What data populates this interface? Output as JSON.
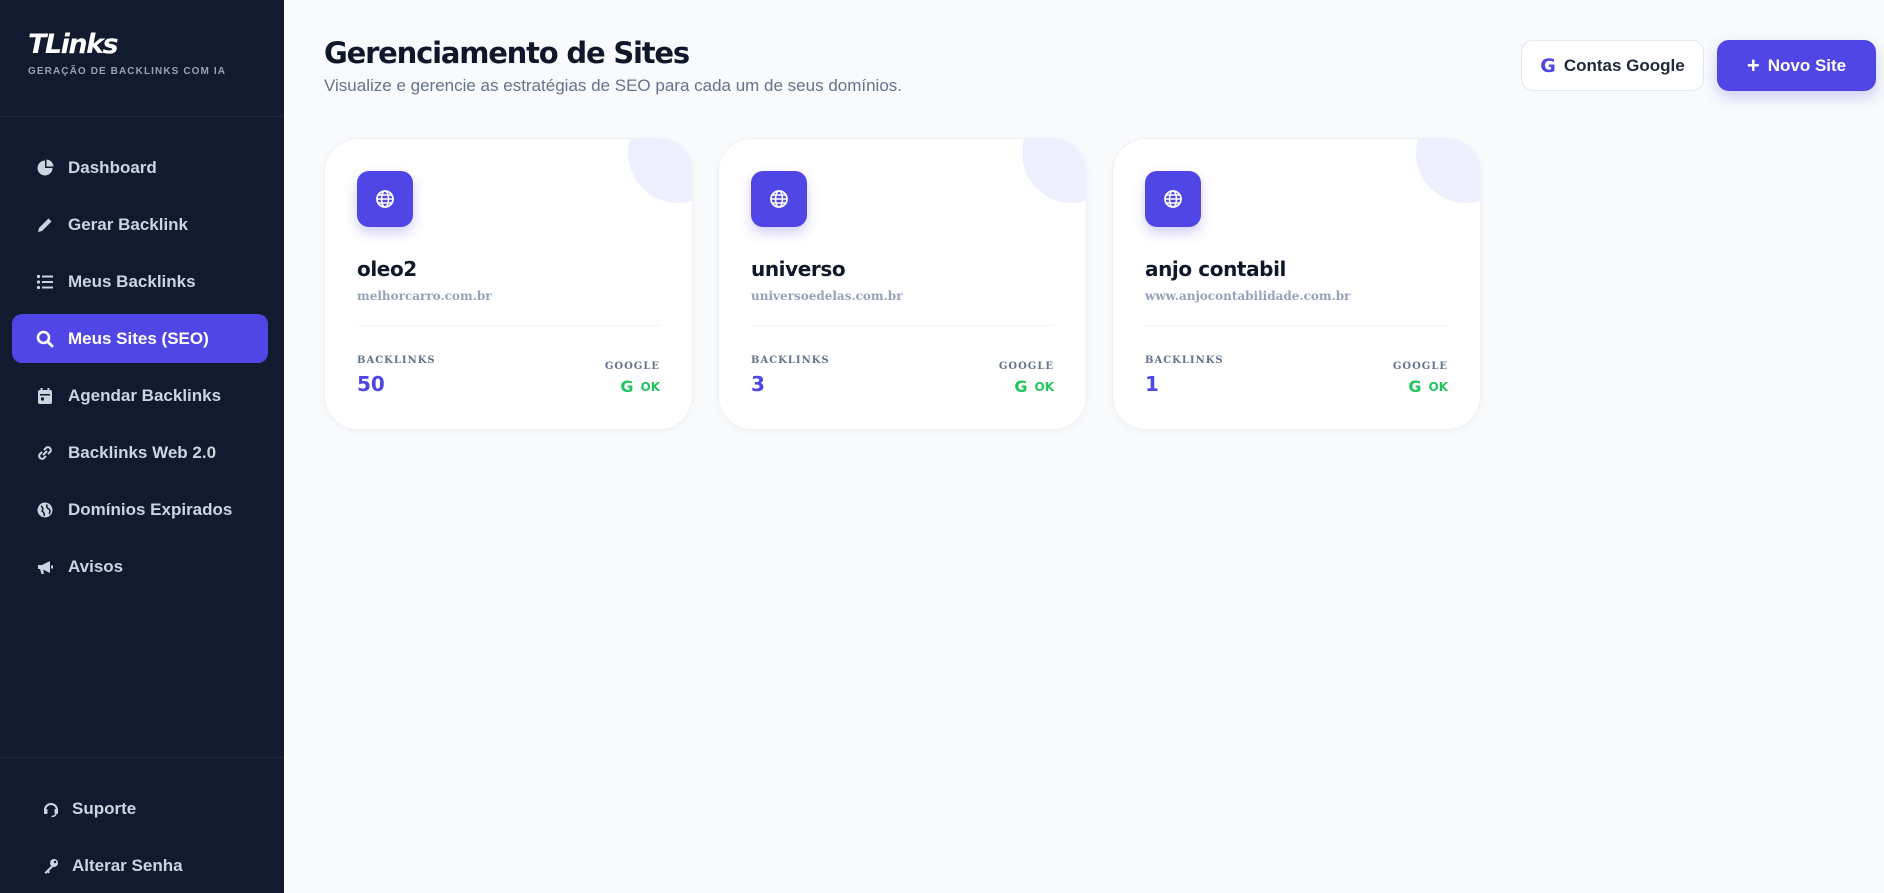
{
  "brand": {
    "name": "TLinks",
    "tagline": "GERAÇÃO DE BACKLINKS COM IA"
  },
  "sidebar": {
    "items": [
      {
        "label": "Dashboard",
        "icon": "pie-chart-icon",
        "active": false
      },
      {
        "label": "Gerar Backlink",
        "icon": "pencil-icon",
        "active": false
      },
      {
        "label": "Meus Backlinks",
        "icon": "list-icon",
        "active": false
      },
      {
        "label": "Meus Sites (SEO)",
        "icon": "search-icon",
        "active": true
      },
      {
        "label": "Agendar Backlinks",
        "icon": "calendar-icon",
        "active": false
      },
      {
        "label": "Backlinks Web 2.0",
        "icon": "link-icon",
        "active": false
      },
      {
        "label": "Domínios Expirados",
        "icon": "globe-icon",
        "active": false
      },
      {
        "label": "Avisos",
        "icon": "megaphone-icon",
        "active": false
      }
    ],
    "bottom": [
      {
        "label": "Suporte",
        "icon": "headset-icon"
      },
      {
        "label": "Alterar Senha",
        "icon": "key-icon"
      }
    ]
  },
  "header": {
    "title": "Gerenciamento de Sites",
    "subtitle": "Visualize e gerencie as estratégias de SEO para cada um de seus domínios.",
    "google_button": "Contas Google",
    "google_glyph": "G",
    "new_button": "Novo Site",
    "new_glyph": "+"
  },
  "labels": {
    "backlinks": "BACKLINKS",
    "google": "GOOGLE"
  },
  "sites": [
    {
      "name": "oleo2",
      "domain": "melhorcarro.com.br",
      "backlinks": "50",
      "google_status": "OK"
    },
    {
      "name": "universo",
      "domain": "universoedelas.com.br",
      "backlinks": "3",
      "google_status": "OK"
    },
    {
      "name": "anjo contabil",
      "domain": "www.anjocontabilidade.com.br",
      "backlinks": "1",
      "google_status": "OK"
    }
  ],
  "colors": {
    "accent": "#4f46e5",
    "sidebar_bg": "#111a2e",
    "status_ok": "#22c55e"
  }
}
